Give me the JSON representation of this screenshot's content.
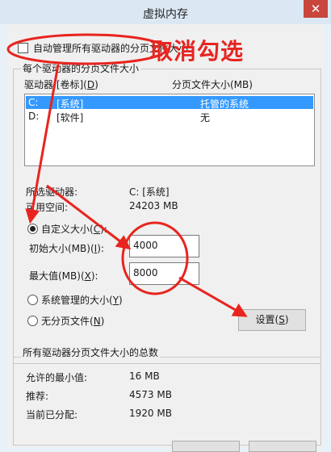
{
  "window": {
    "title": "虚拟内存",
    "close_glyph": "✕"
  },
  "auto_manage": {
    "label": "自动管理所有驱动器的分页文件大小",
    "checked": false
  },
  "annotation": {
    "text": "取消勾选",
    "color": "#e8241f"
  },
  "drive_group": {
    "title": "每个驱动器的分页文件大小",
    "col_drive": "驱动器 [卷标](D)",
    "col_size": "分页文件大小(MB)",
    "rows": [
      {
        "drive": "C:",
        "label": "[系统]",
        "size": "托管的系统",
        "selected": true
      },
      {
        "drive": "D:",
        "label": "[软件]",
        "size": "无",
        "selected": false
      }
    ],
    "selected_drive_label": "所选驱动器:",
    "selected_drive_value": "C:  [系统]",
    "free_space_label": "可用空间:",
    "free_space_value": "24203 MB",
    "custom_size_label": "自定义大小(C):",
    "initial_size_label": "初始大小(MB)(I):",
    "initial_size_value": "4000",
    "max_size_label": "最大值(MB)(X):",
    "max_size_value": "8000",
    "system_managed_label": "系统管理的大小(Y)",
    "no_paging_label": "无分页文件(N)",
    "set_button": "设置(S)"
  },
  "totals_group": {
    "title": "所有驱动器分页文件大小的总数",
    "min_label": "允许的最小值:",
    "min_value": "16 MB",
    "recommended_label": "推荐:",
    "recommended_value": "4573 MB",
    "current_label": "当前已分配:",
    "current_value": "1920 MB"
  }
}
